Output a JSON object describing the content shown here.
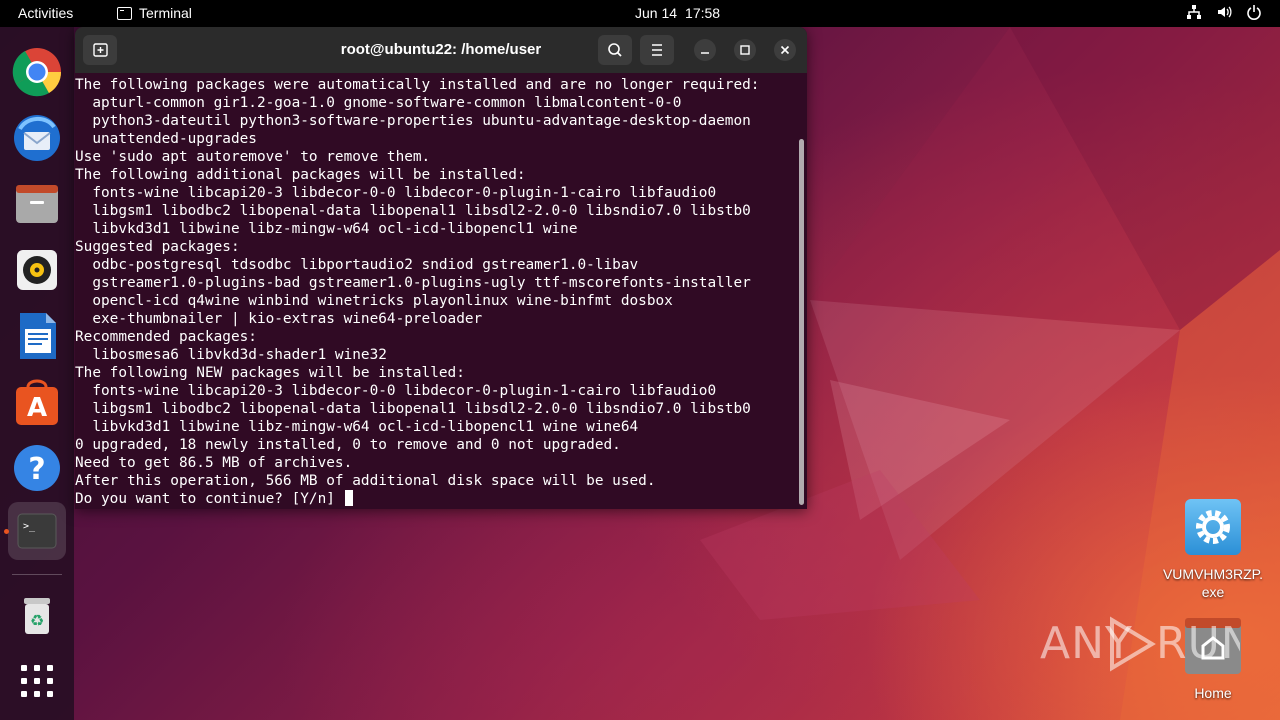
{
  "topbar": {
    "activities": "Activities",
    "app_name": "Terminal",
    "date": "Jun 14",
    "time": "17:58",
    "tray_icons": [
      "network-icon",
      "volume-icon",
      "power-icon"
    ]
  },
  "dock": {
    "items": [
      {
        "name": "chrome",
        "icon": "chrome-icon"
      },
      {
        "name": "thunderbird",
        "icon": "thunderbird-icon"
      },
      {
        "name": "files",
        "icon": "files-icon"
      },
      {
        "name": "rhythmbox",
        "icon": "rhythmbox-icon"
      },
      {
        "name": "writer",
        "icon": "writer-icon"
      },
      {
        "name": "software",
        "icon": "software-icon"
      },
      {
        "name": "help",
        "icon": "help-icon"
      },
      {
        "name": "terminal",
        "icon": "terminal-icon",
        "active": true
      },
      {
        "name": "trash",
        "icon": "trash-icon"
      },
      {
        "name": "apps",
        "icon": "app-grid-icon"
      }
    ]
  },
  "terminal": {
    "title": "root@ubuntu22: /home/user",
    "lines": [
      "The following packages were automatically installed and are no longer required:",
      "  apturl-common gir1.2-goa-1.0 gnome-software-common libmalcontent-0-0",
      "  python3-dateutil python3-software-properties ubuntu-advantage-desktop-daemon",
      "  unattended-upgrades",
      "Use 'sudo apt autoremove' to remove them.",
      "The following additional packages will be installed:",
      "  fonts-wine libcapi20-3 libdecor-0-0 libdecor-0-plugin-1-cairo libfaudio0",
      "  libgsm1 libodbc2 libopenal-data libopenal1 libsdl2-2.0-0 libsndio7.0 libstb0",
      "  libvkd3d1 libwine libz-mingw-w64 ocl-icd-libopencl1 wine",
      "Suggested packages:",
      "  odbc-postgresql tdsodbc libportaudio2 sndiod gstreamer1.0-libav",
      "  gstreamer1.0-plugins-bad gstreamer1.0-plugins-ugly ttf-mscorefonts-installer",
      "  opencl-icd q4wine winbind winetricks playonlinux wine-binfmt dosbox",
      "  exe-thumbnailer | kio-extras wine64-preloader",
      "Recommended packages:",
      "  libosmesa6 libvkd3d-shader1 wine32",
      "The following NEW packages will be installed:",
      "  fonts-wine libcapi20-3 libdecor-0-0 libdecor-0-plugin-1-cairo libfaudio0",
      "  libgsm1 libodbc2 libopenal-data libopenal1 libsdl2-2.0-0 libsndio7.0 libstb0",
      "  libvkd3d1 libwine libz-mingw-w64 ocl-icd-libopencl1 wine wine64",
      "0 upgraded, 18 newly installed, 0 to remove and 0 not upgraded.",
      "Need to get 86.5 MB of archives.",
      "After this operation, 566 MB of additional disk space will be used."
    ],
    "prompt": "Do you want to continue? [Y/n] "
  },
  "desktop": {
    "file1_label": "VUMVHM3RZP.\nexe",
    "file1_line1": "VUMVHM3RZP.",
    "file1_line2": "exe",
    "home_label": "Home"
  },
  "watermark": "ANY RUN",
  "colors": {
    "terminal_bg": "#300a24",
    "accent": "#e95420",
    "header_bg": "#2b2b2b"
  }
}
